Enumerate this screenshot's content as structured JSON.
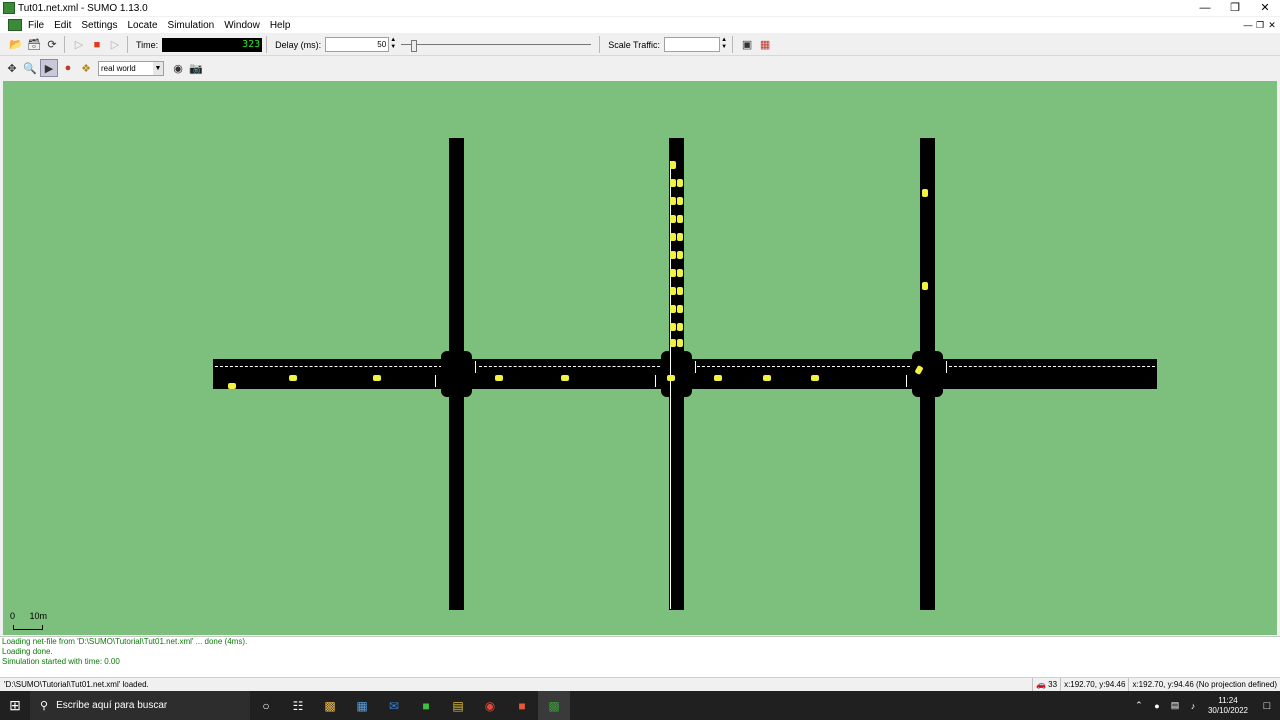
{
  "window": {
    "title": "Tut01.net.xml - SUMO 1.13.0"
  },
  "menu": [
    "File",
    "Edit",
    "Settings",
    "Locate",
    "Simulation",
    "Window",
    "Help"
  ],
  "toolbar": {
    "time_label": "Time:",
    "time_value": "323",
    "delay_label": "Delay (ms):",
    "delay_value": "50",
    "scale_traffic_label": "Scale Traffic:"
  },
  "view": {
    "scheme": "real world"
  },
  "scale_bar": {
    "zero": "0",
    "length": "10m"
  },
  "log": [
    "Loading net-file from 'D:\\SUMO\\Tutorial\\Tut01.net.xml' ... done (4ms).",
    "Loading done.",
    "Simulation started with time: 0.00"
  ],
  "status": {
    "message": "'D:\\SUMO\\Tutorial\\Tut01.net.xml' loaded.",
    "vehicle_count": "33",
    "coords": "x:192.70, y:94.46",
    "coords_geo": "x:192.70, y:94.46 (No projection defined)"
  },
  "taskbar": {
    "search_placeholder": "Escribe aquí para buscar",
    "time": "11:24",
    "date": "30/10/2022"
  },
  "colors": {
    "canvas": "#7dbf7d",
    "road": "#000000",
    "vehicle": "#f2f242",
    "time_digits": "#23e623"
  }
}
